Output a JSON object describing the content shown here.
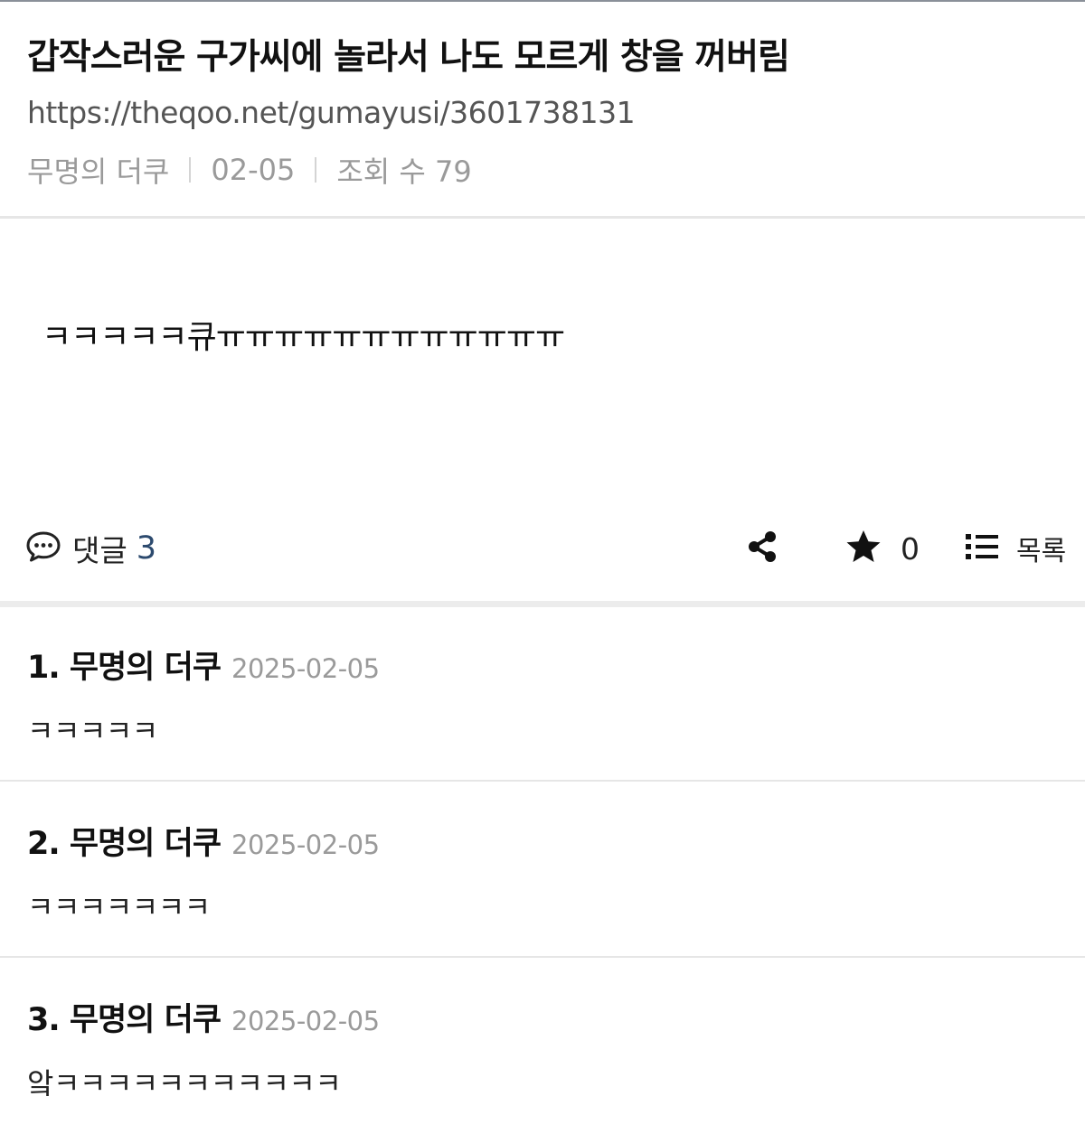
{
  "post": {
    "title": "갑작스러운 구가씨에 놀라서 나도 모르게 창을 꺼버림",
    "url": "https://theqoo.net/gumayusi/3601738131",
    "author": "무명의 더쿠",
    "date": "02-05",
    "views": "조회 수 79",
    "body": "ㅋㅋㅋㅋㅋ큐ㅠㅠㅠㅠㅠㅠㅠㅠㅠㅠㅠㅠ"
  },
  "actions": {
    "comment_label": "댓글",
    "comment_count": "3",
    "star_count": "0",
    "list_label": "목록",
    "icons": {
      "comment": "speech-bubble-icon",
      "share": "share-icon",
      "star": "star-icon",
      "list": "list-icon"
    }
  },
  "comments": [
    {
      "number_author": "1. 무명의 더쿠",
      "date": "2025-02-05",
      "text": "ㅋㅋㅋㅋㅋ"
    },
    {
      "number_author": "2. 무명의 더쿠",
      "date": "2025-02-05",
      "text": "ㅋㅋㅋㅋㅋㅋㅋ"
    },
    {
      "number_author": "3. 무명의 더쿠",
      "date": "2025-02-05",
      "text": "앜ㅋㅋㅋㅋㅋㅋㅋㅋㅋㅋㅋ"
    }
  ],
  "colors": {
    "accent_count": "#2c4a6e",
    "muted_text": "#9a9a9a",
    "divider": "#e6e6e6"
  }
}
